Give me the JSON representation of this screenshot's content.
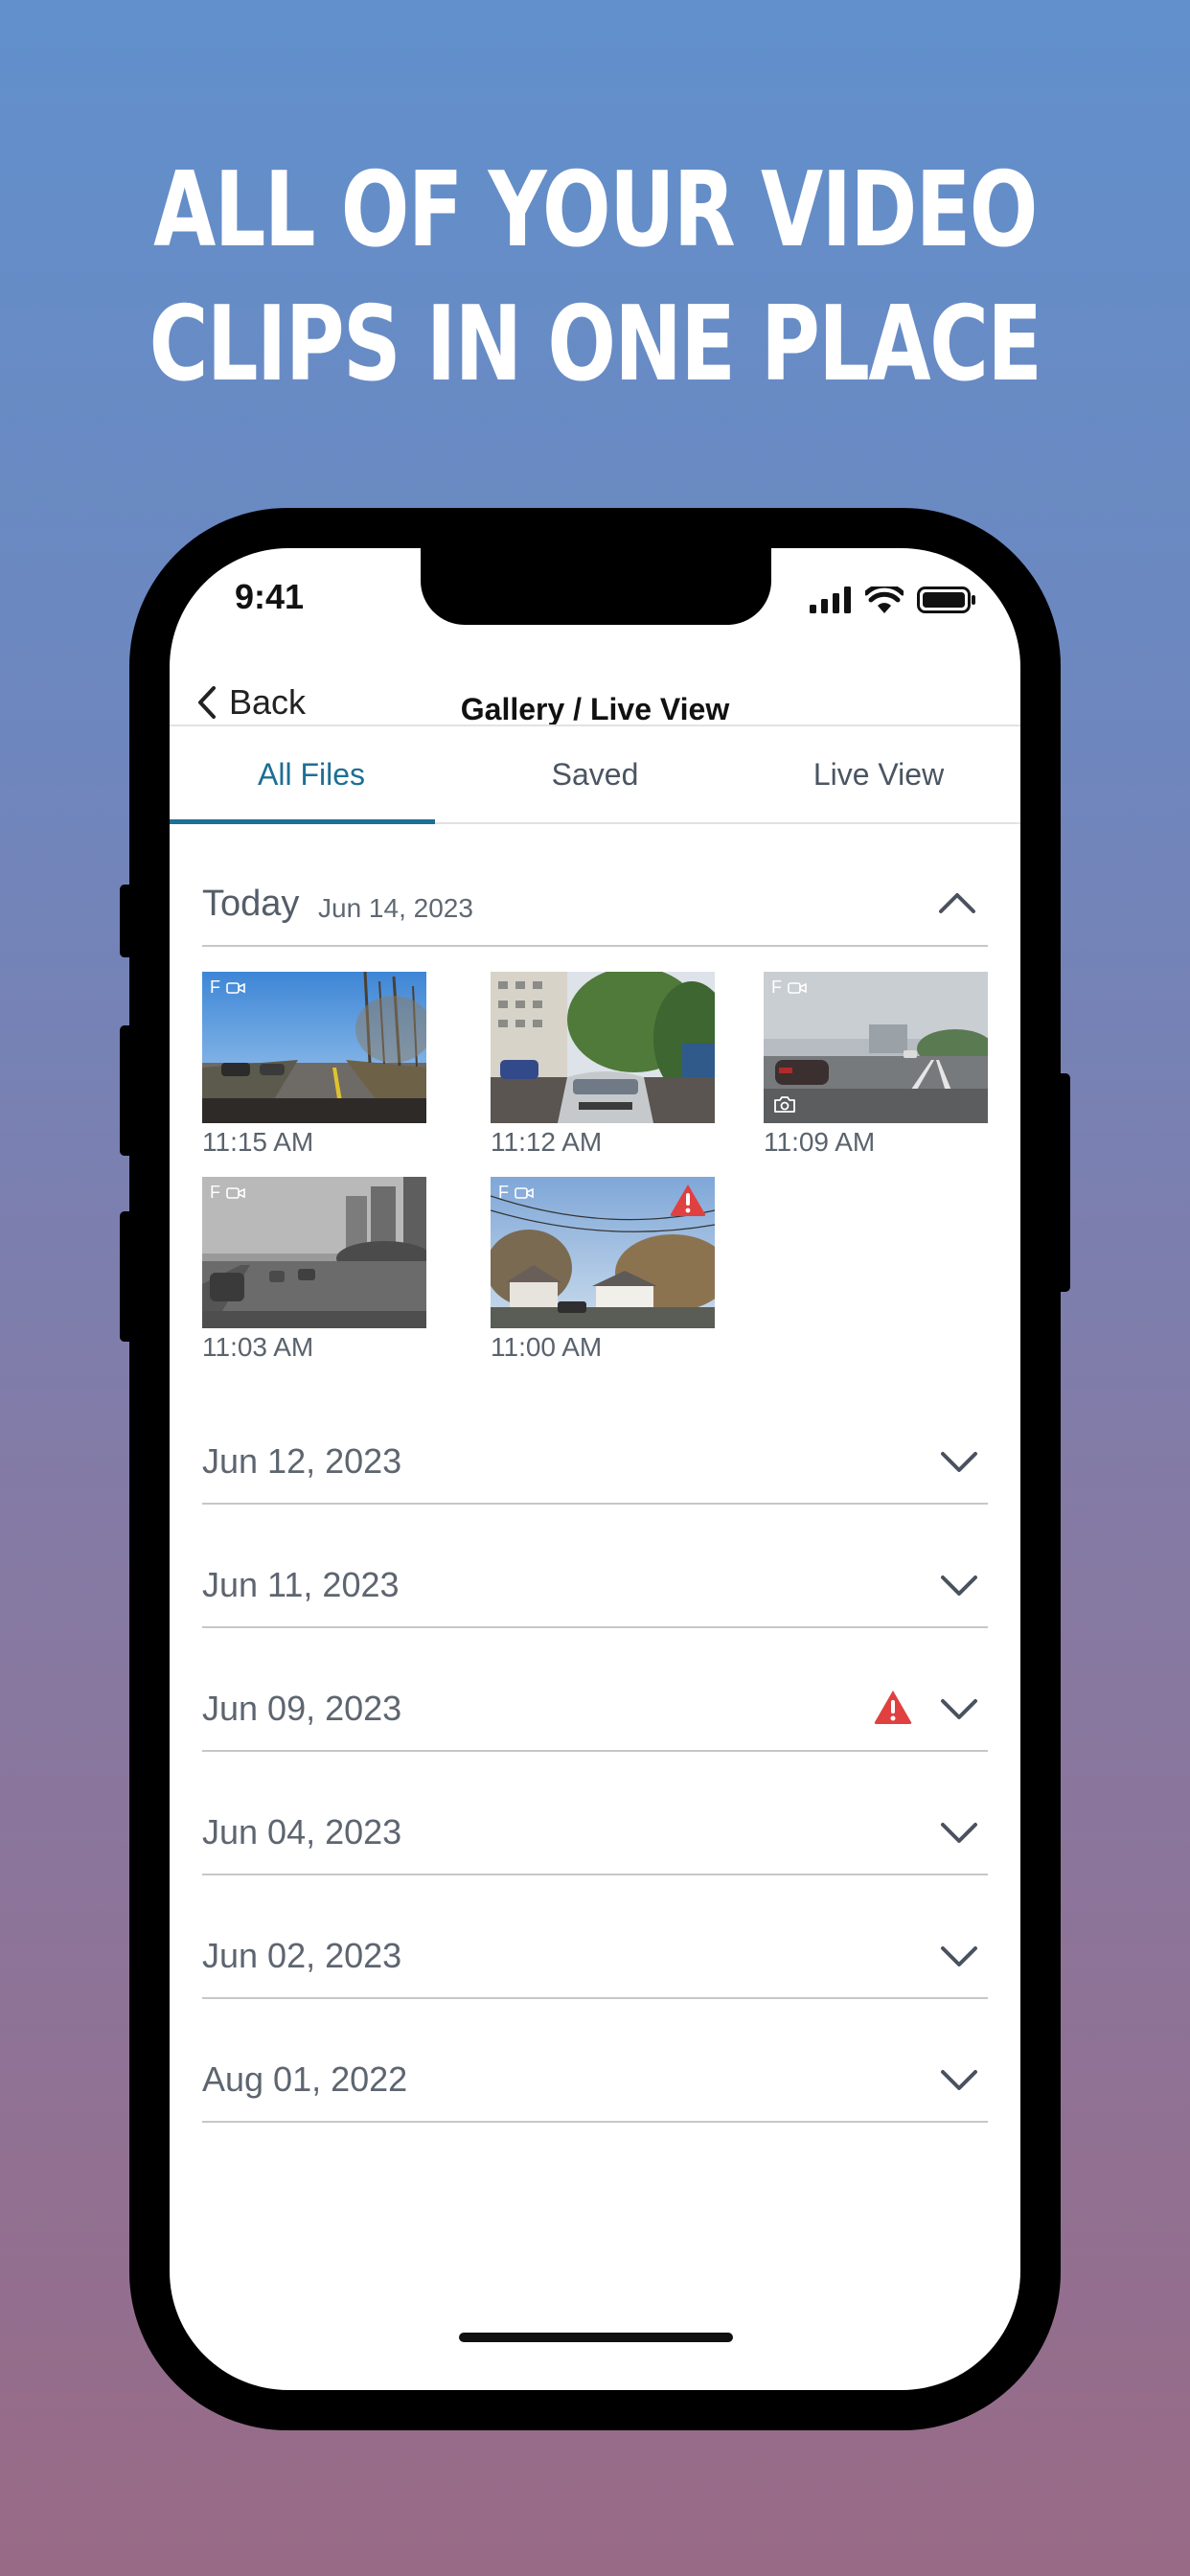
{
  "headline": {
    "line1": "ALL OF YOUR VIDEO",
    "line2": "CLIPS IN ONE PLACE"
  },
  "status_bar": {
    "time": "9:41",
    "icons": [
      "signal-icon",
      "wifi-icon",
      "battery-icon"
    ]
  },
  "nav": {
    "back_label": "Back",
    "title": "Gallery / Live View"
  },
  "tabs": [
    {
      "label": "All Files",
      "active": true
    },
    {
      "label": "Saved",
      "active": false
    },
    {
      "label": "Live View",
      "active": false
    }
  ],
  "today": {
    "label": "Today",
    "date": "Jun 14, 2023",
    "expanded": true,
    "clips": [
      {
        "time": "11:15 AM",
        "badge": "F",
        "alert": false,
        "photo": false
      },
      {
        "time": "11:12 AM",
        "badge": "",
        "alert": false,
        "photo": false
      },
      {
        "time": "11:09 AM",
        "badge": "F",
        "alert": false,
        "photo": true
      },
      {
        "time": "11:03 AM",
        "badge": "F",
        "alert": false,
        "photo": false
      },
      {
        "time": "11:00 AM",
        "badge": "F",
        "alert": true,
        "photo": false
      }
    ]
  },
  "date_groups": [
    {
      "label": "Jun 12, 2023",
      "alert": false
    },
    {
      "label": "Jun 11, 2023",
      "alert": false
    },
    {
      "label": "Jun 09, 2023",
      "alert": true
    },
    {
      "label": "Jun 04, 2023",
      "alert": false
    },
    {
      "label": "Jun 02, 2023",
      "alert": false
    },
    {
      "label": "Aug 01, 2022",
      "alert": false
    }
  ],
  "colors": {
    "accent": "#1d6f93",
    "alert": "#e04040",
    "text_gray": "#5d6570"
  }
}
